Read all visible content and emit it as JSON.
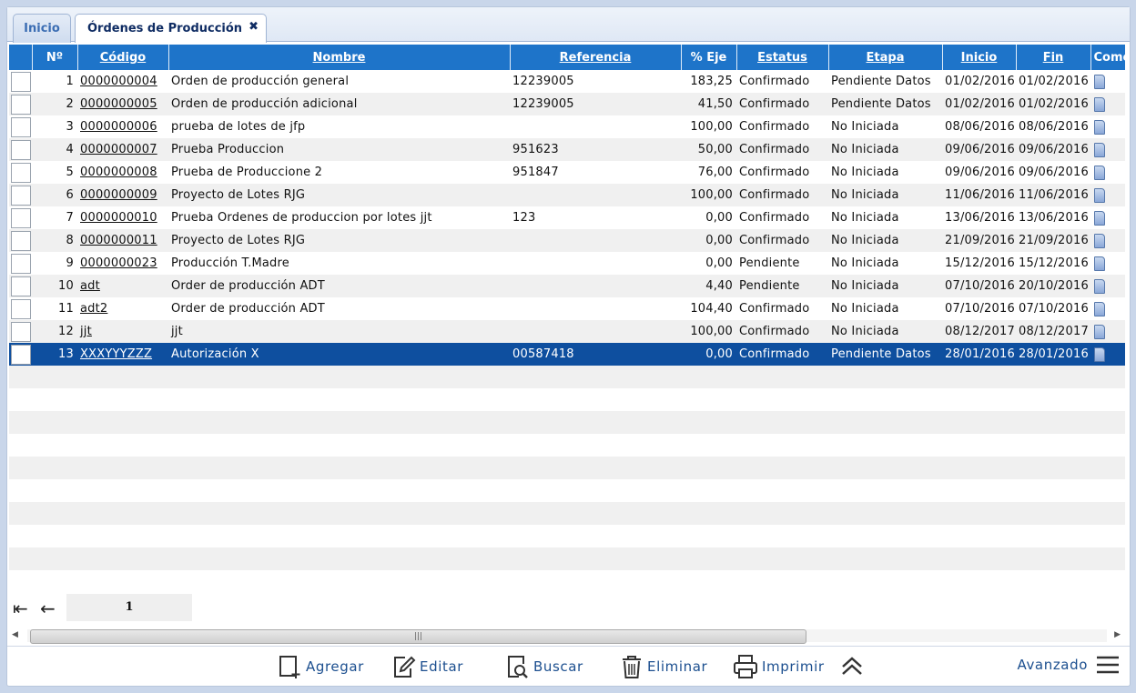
{
  "tabs": [
    {
      "label": "Inicio",
      "active": false
    },
    {
      "label": "Órdenes de Producción",
      "active": true
    }
  ],
  "table": {
    "columns": [
      "Nº",
      "Código",
      "Nombre",
      "Referencia",
      "% Eje",
      "Estatus",
      "Etapa",
      "Inicio",
      "Fin",
      "Come"
    ],
    "rows": [
      {
        "n": "1",
        "codigo": "0000000004",
        "nombre": "Orden de producción general",
        "referencia": "12239005",
        "eje": "183,25",
        "estatus": "Confirmado",
        "etapa": "Pendiente Datos",
        "inicio": "01/02/2016",
        "fin": "01/02/2016"
      },
      {
        "n": "2",
        "codigo": "0000000005",
        "nombre": "Orden de producción adicional",
        "referencia": "12239005",
        "eje": "41,50",
        "estatus": "Confirmado",
        "etapa": "Pendiente Datos",
        "inicio": "01/02/2016",
        "fin": "01/02/2016"
      },
      {
        "n": "3",
        "codigo": "0000000006",
        "nombre": "prueba de lotes de jfp",
        "referencia": "",
        "eje": "100,00",
        "estatus": "Confirmado",
        "etapa": "No Iniciada",
        "inicio": "08/06/2016",
        "fin": "08/06/2016"
      },
      {
        "n": "4",
        "codigo": "0000000007",
        "nombre": "Prueba Produccion",
        "referencia": "951623",
        "eje": "50,00",
        "estatus": "Confirmado",
        "etapa": "No Iniciada",
        "inicio": "09/06/2016",
        "fin": "09/06/2016"
      },
      {
        "n": "5",
        "codigo": "0000000008",
        "nombre": "Prueba de Produccione 2",
        "referencia": "951847",
        "eje": "76,00",
        "estatus": "Confirmado",
        "etapa": "No Iniciada",
        "inicio": "09/06/2016",
        "fin": "09/06/2016"
      },
      {
        "n": "6",
        "codigo": "0000000009",
        "nombre": "Proyecto de Lotes RJG",
        "referencia": "",
        "eje": "100,00",
        "estatus": "Confirmado",
        "etapa": "No Iniciada",
        "inicio": "11/06/2016",
        "fin": "11/06/2016"
      },
      {
        "n": "7",
        "codigo": "0000000010",
        "nombre": "Prueba Ordenes de produccion por lotes jjt",
        "referencia": "123",
        "eje": "0,00",
        "estatus": "Confirmado",
        "etapa": "No Iniciada",
        "inicio": "13/06/2016",
        "fin": "13/06/2016"
      },
      {
        "n": "8",
        "codigo": "0000000011",
        "nombre": "Proyecto de Lotes RJG",
        "referencia": "",
        "eje": "0,00",
        "estatus": "Confirmado",
        "etapa": "No Iniciada",
        "inicio": "21/09/2016",
        "fin": "21/09/2016"
      },
      {
        "n": "9",
        "codigo": "0000000023",
        "nombre": "Producción T.Madre",
        "referencia": "",
        "eje": "0,00",
        "estatus": "Pendiente",
        "etapa": "No Iniciada",
        "inicio": "15/12/2016",
        "fin": "15/12/2016"
      },
      {
        "n": "10",
        "codigo": "adt",
        "nombre": "Order de producción ADT",
        "referencia": "",
        "eje": "4,40",
        "estatus": "Pendiente",
        "etapa": "No Iniciada",
        "inicio": "07/10/2016",
        "fin": "20/10/2016"
      },
      {
        "n": "11",
        "codigo": "adt2",
        "nombre": "Order de producción ADT",
        "referencia": "",
        "eje": "104,40",
        "estatus": "Confirmado",
        "etapa": "No Iniciada",
        "inicio": "07/10/2016",
        "fin": "07/10/2016"
      },
      {
        "n": "12",
        "codigo": "jjt",
        "nombre": "jjt",
        "referencia": "",
        "eje": "100,00",
        "estatus": "Confirmado",
        "etapa": "No Iniciada",
        "inicio": "08/12/2017",
        "fin": "08/12/2017"
      },
      {
        "n": "13",
        "codigo": "XXXYYYZZZ",
        "nombre": "Autorización X",
        "referencia": "00587418",
        "eje": "0,00",
        "estatus": "Confirmado",
        "etapa": "Pendiente Datos",
        "inicio": "28/01/2016",
        "fin": "28/01/2016",
        "selected": true
      }
    ]
  },
  "pager": {
    "page": "1"
  },
  "toolbar": {
    "add": "Agregar",
    "edit": "Editar",
    "search": "Buscar",
    "delete": "Eliminar",
    "print": "Imprimir",
    "advanced": "Avanzado"
  },
  "icons": [
    "close-icon",
    "first-page-icon",
    "prev-page-icon",
    "add-icon",
    "edit-icon",
    "search-icon",
    "trash-icon",
    "print-icon",
    "collapse-up-icon",
    "menu-icon",
    "comment-icon"
  ],
  "colors": {
    "header": "#1e74c9",
    "selected_row": "#0e4f9f",
    "toolbar_text": "#1c4f8f"
  }
}
